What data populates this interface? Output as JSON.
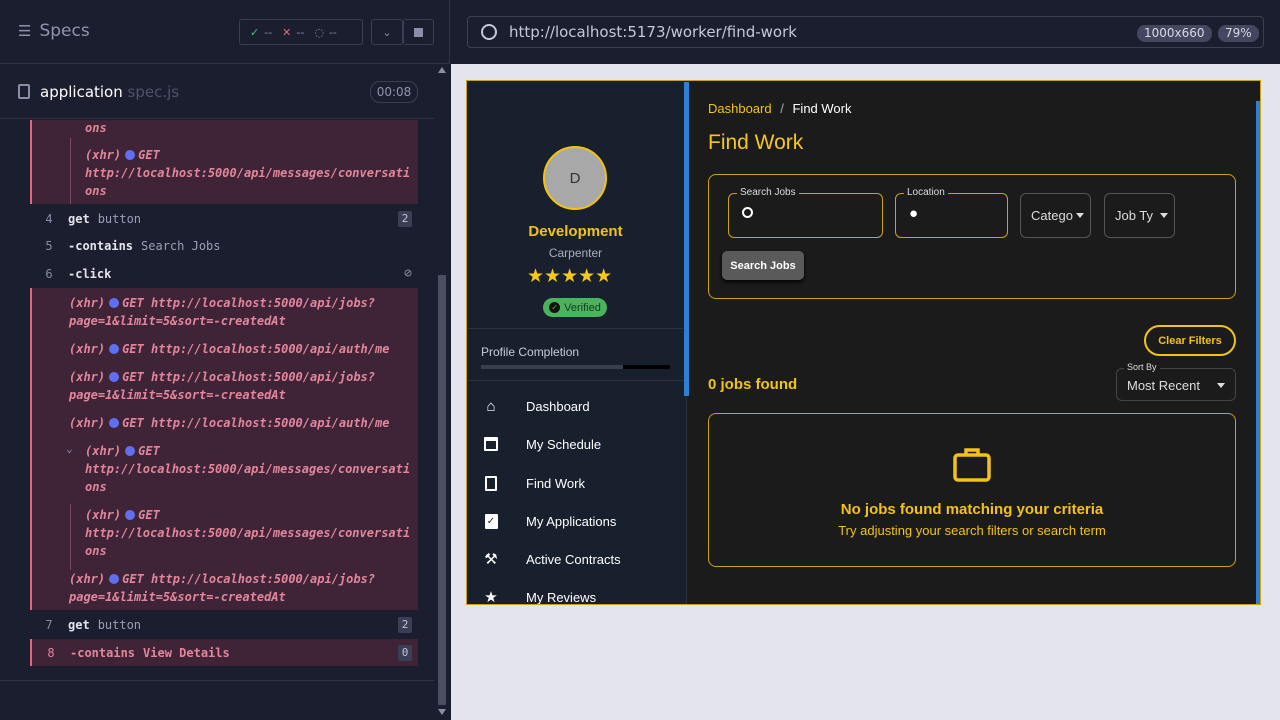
{
  "runner": {
    "title": "Specs",
    "stats": {
      "passed": "--",
      "failed": "--",
      "pending": "--"
    },
    "spec": {
      "name": "application",
      "ext": " spec.js",
      "time": "00:08"
    }
  },
  "log": {
    "xhr": "(xhr)",
    "get": "GET",
    "url_conv_tail": "ons",
    "url_conv": "http://localhost:5000/api/messages/conversati",
    "url_jobs": "http://localhost:5000/api/jobs?",
    "url_jobs_q": "page=1&limit=5&sort=-createdAt",
    "url_auth": "http://localhost:5000/api/auth/me",
    "cmds": [
      {
        "num": "4",
        "kw": "get",
        "arg": "button",
        "badge": "2"
      },
      {
        "num": "5",
        "kw": "-contains",
        "arg": "Search Jobs"
      },
      {
        "num": "6",
        "kw": "-click",
        "arg": ""
      },
      {
        "num": "7",
        "kw": "get",
        "arg": "button",
        "badge": "2"
      },
      {
        "num": "8",
        "kw": "-contains",
        "arg": "View Details",
        "badge": "0"
      }
    ]
  },
  "browser": {
    "url": "http://localhost:5173/worker/find-work",
    "viewport": "1000x660",
    "zoom": "79%"
  },
  "app": {
    "profile": {
      "initial": "D",
      "name": "Development",
      "role": "Carpenter",
      "stars": "★★★★★",
      "verified": "Verified",
      "completion_label": "Profile Completion"
    },
    "nav": [
      "Dashboard",
      "My Schedule",
      "Find Work",
      "My Applications",
      "Active Contracts",
      "My Reviews"
    ],
    "breadcrumb": {
      "home": "Dashboard",
      "sep": "/",
      "current": "Find Work"
    },
    "title": "Find Work",
    "filters": {
      "search_label": "Search Jobs",
      "location_label": "Location",
      "category": "Catego",
      "jobtype": "Job Ty",
      "search_button": "Search Jobs",
      "clear_button": "Clear Filters"
    },
    "results": {
      "count": "0 jobs found",
      "sort_label": "Sort By",
      "sort_value": "Most Recent"
    },
    "empty": {
      "title": "No jobs found matching your criteria",
      "subtitle": "Try adjusting your search filters or search term"
    },
    "colors": {
      "accent": "#f0c419",
      "sidebar": "#18202e",
      "log_error_bg": "#3f2337"
    }
  }
}
